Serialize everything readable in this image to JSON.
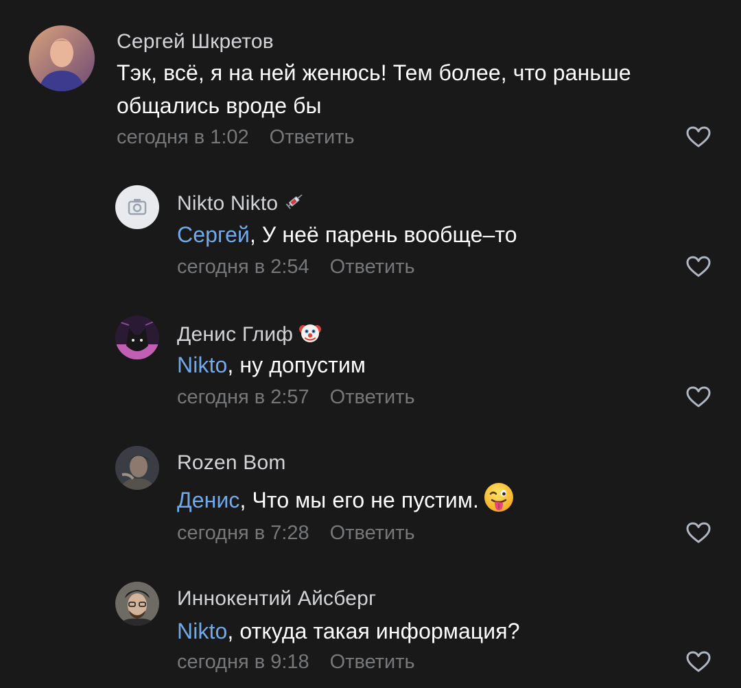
{
  "comments": [
    {
      "author": "Сергей Шкретов",
      "text_lines": [
        "Тэк, всё, я на ней женюсь! Тем более, что раньше",
        "общались вроде бы"
      ],
      "time": "сегодня в 1:02",
      "reply_label": "Ответить",
      "avatar_icon": "user-photo"
    },
    {
      "author": "Nikto Nikto",
      "author_badge_icon": "syringe-emoji",
      "mention": "Сергей",
      "text": ", У неё парень вообще–то",
      "time": "сегодня в 2:54",
      "reply_label": "Ответить",
      "avatar_icon": "camera-placeholder"
    },
    {
      "author": "Денис Глиф",
      "author_badge_icon": "clown-emoji",
      "mention": "Nikto",
      "text": ", ну допустим",
      "time": "сегодня в 2:57",
      "reply_label": "Ответить",
      "avatar_icon": "wolf-art"
    },
    {
      "author": "Rozen Bom",
      "mention": "Денис",
      "text": ", Что мы его не пустим.",
      "text_emoji_icon": "winking-tongue-emoji",
      "time": "сегодня в 7:28",
      "reply_label": "Ответить",
      "avatar_icon": "user-photo"
    },
    {
      "author": "Иннокентий Айсберг",
      "mention": "Nikto",
      "text": ", откуда такая информация?",
      "time": "сегодня в 9:18",
      "reply_label": "Ответить",
      "avatar_icon": "user-photo"
    }
  ],
  "colors": {
    "background": "#19191a",
    "text": "#ffffff",
    "author": "#d2d4d7",
    "mention": "#71aaeb",
    "meta": "#76787a",
    "like_icon": "#aeb7c2"
  },
  "icons": {
    "like": "heart-outline-icon"
  }
}
